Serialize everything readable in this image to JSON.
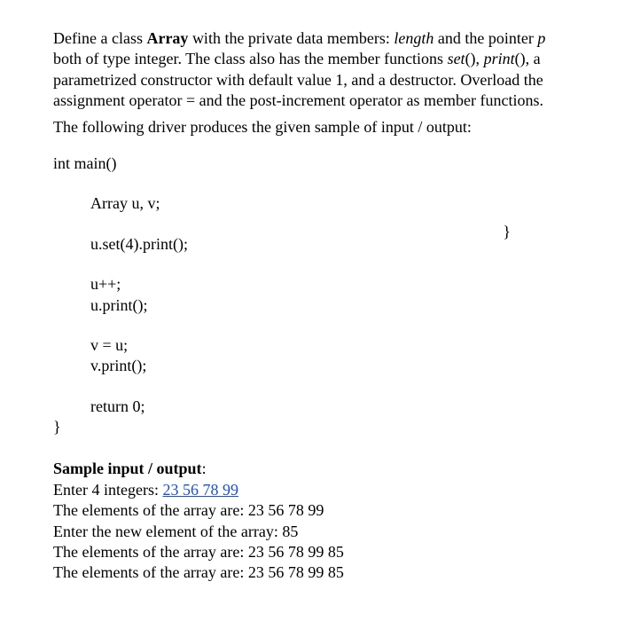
{
  "problem": {
    "p1_a": "Define a class ",
    "p1_array": "Array",
    "p1_b": " with the private data members: ",
    "p1_length": "length",
    "p1_c": " and the pointer ",
    "p1_p": "p",
    "p1_d": " both of type integer. The class also has the member functions ",
    "p1_set": "set",
    "p1_e": "(), ",
    "p1_print": "print",
    "p1_f": "(), a parametrized constructor with default value 1, and a destructor. Overload the assignment operator = and the post-increment operator as member functions.",
    "p2": "The following driver produces the given sample of input / output:"
  },
  "code": {
    "l1": "int main()",
    "l2": "Array u, v;",
    "l3": "u.set(4).print();",
    "l4": "u++;",
    "l5": "u.print();",
    "l6": "v = u;",
    "l7": "v.print();",
    "l8": "return 0;",
    "l9": "}",
    "stray": "}"
  },
  "sample": {
    "header": "Sample input / output",
    "colon": ":",
    "l1a": "Enter 4 integers: ",
    "l1_input": "23 56 78 99",
    "l2": "The elements of the array are: 23   56   78   99",
    "l3": "Enter the new element of the array: 85",
    "l4": "The elements of the array are: 23   56   78   99   85",
    "l5": "The elements of the array are: 23   56   78   99   85"
  }
}
